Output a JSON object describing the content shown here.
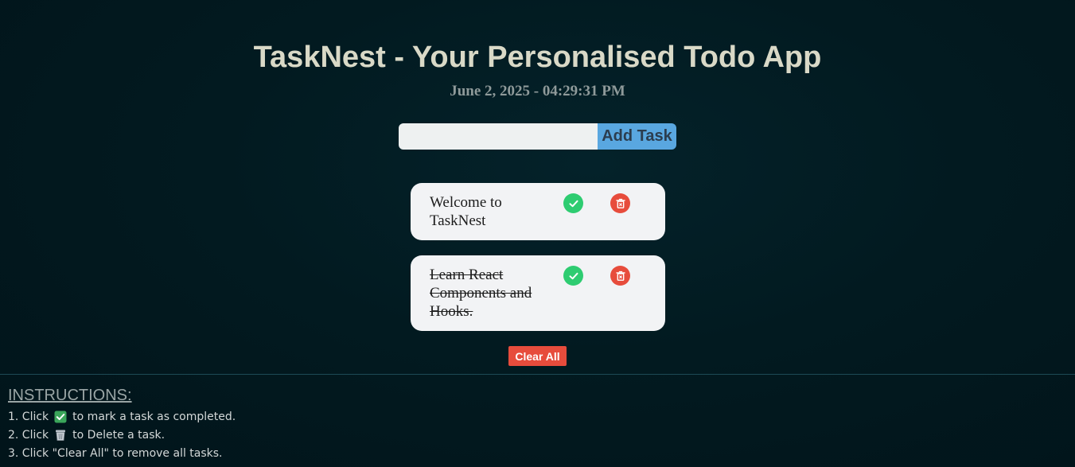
{
  "header": {
    "title": "TaskNest - Your Personalised Todo App",
    "datetime": "June 2, 2025 - 04:29:31 PM"
  },
  "form": {
    "input_value": "",
    "input_placeholder": "",
    "add_label": "Add Task"
  },
  "tasks": [
    {
      "text": "Welcome to TaskNest",
      "completed": false
    },
    {
      "text": "Learn React Components and Hooks.",
      "completed": true
    }
  ],
  "actions": {
    "clear_all_label": "Clear All"
  },
  "instructions": {
    "heading": "INSTRUCTIONS:",
    "line1_prefix": "1. Click",
    "line1_suffix": "to mark a task as completed.",
    "line2_prefix": "2. Click",
    "line2_suffix": "to Delete a task.",
    "line3": "3. Click \"Clear All\" to remove all tasks."
  },
  "icons": {
    "complete": "check-circle-icon",
    "delete": "trash-icon"
  },
  "colors": {
    "check_green": "#2ecc71",
    "delete_red": "#e74c3c",
    "add_button_blue": "#59a7e0",
    "card_bg": "#f2f3f5"
  }
}
